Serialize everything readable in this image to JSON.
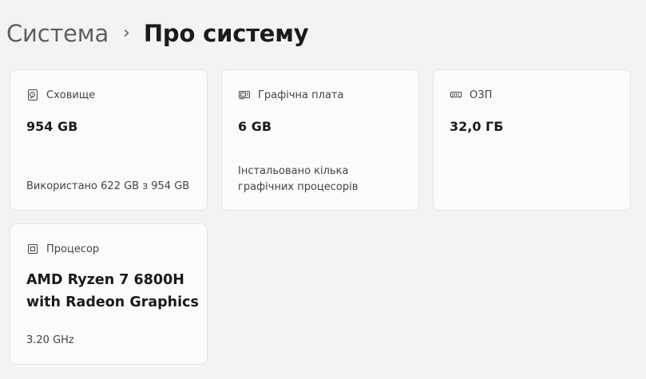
{
  "breadcrumb": {
    "parent": "Система",
    "separator": "›",
    "current": "Про систему"
  },
  "cards": {
    "storage": {
      "icon": "storage-drive-icon",
      "label": "Сховище",
      "value": "954 GB",
      "detail": "Використано 622 GB з 954 GB"
    },
    "gpu": {
      "icon": "graphics-card-icon",
      "label": "Графічна плата",
      "value": "6 GB",
      "detail_line1": "Інстальовано кілька",
      "detail_line2": "графічних процесорів"
    },
    "ram": {
      "icon": "memory-module-icon",
      "label": "ОЗП",
      "value": "32,0 ГБ"
    },
    "cpu": {
      "icon": "processor-chip-icon",
      "label": "Процесор",
      "value_line1": "AMD Ryzen 7 6800H",
      "value_line2": "with Radeon Graphics",
      "detail": "3.20 GHz"
    }
  }
}
